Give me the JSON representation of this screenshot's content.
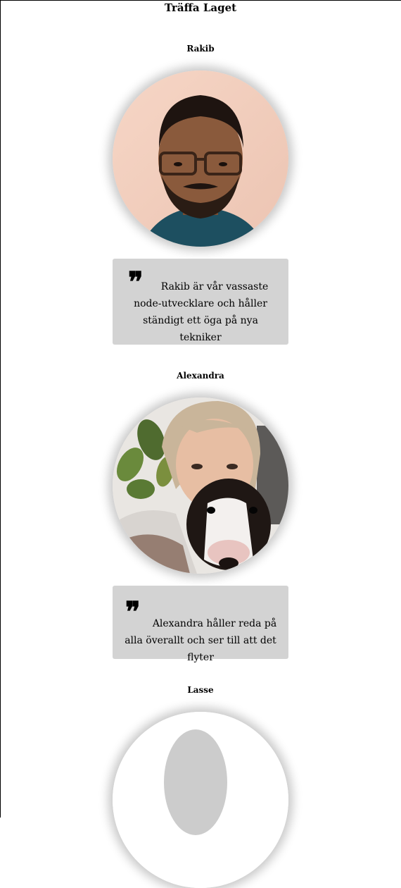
{
  "page": {
    "title": "Träffa Laget"
  },
  "members": [
    {
      "name": "Rakib",
      "quote_mark": "❞",
      "quote": "Rakib är vår vassaste node-utvecklare och håller ständigt ett öga på nya tekniker"
    },
    {
      "name": "Alexandra",
      "quote_mark": "❞",
      "quote": "Alexandra håller reda på alla överallt och ser till att det flyter"
    },
    {
      "name": "Lasse",
      "quote_mark": "❞",
      "quote": ""
    }
  ],
  "colors": {
    "quote_background": "#d3d3d3",
    "placeholder_avatar": "#cccccc"
  }
}
